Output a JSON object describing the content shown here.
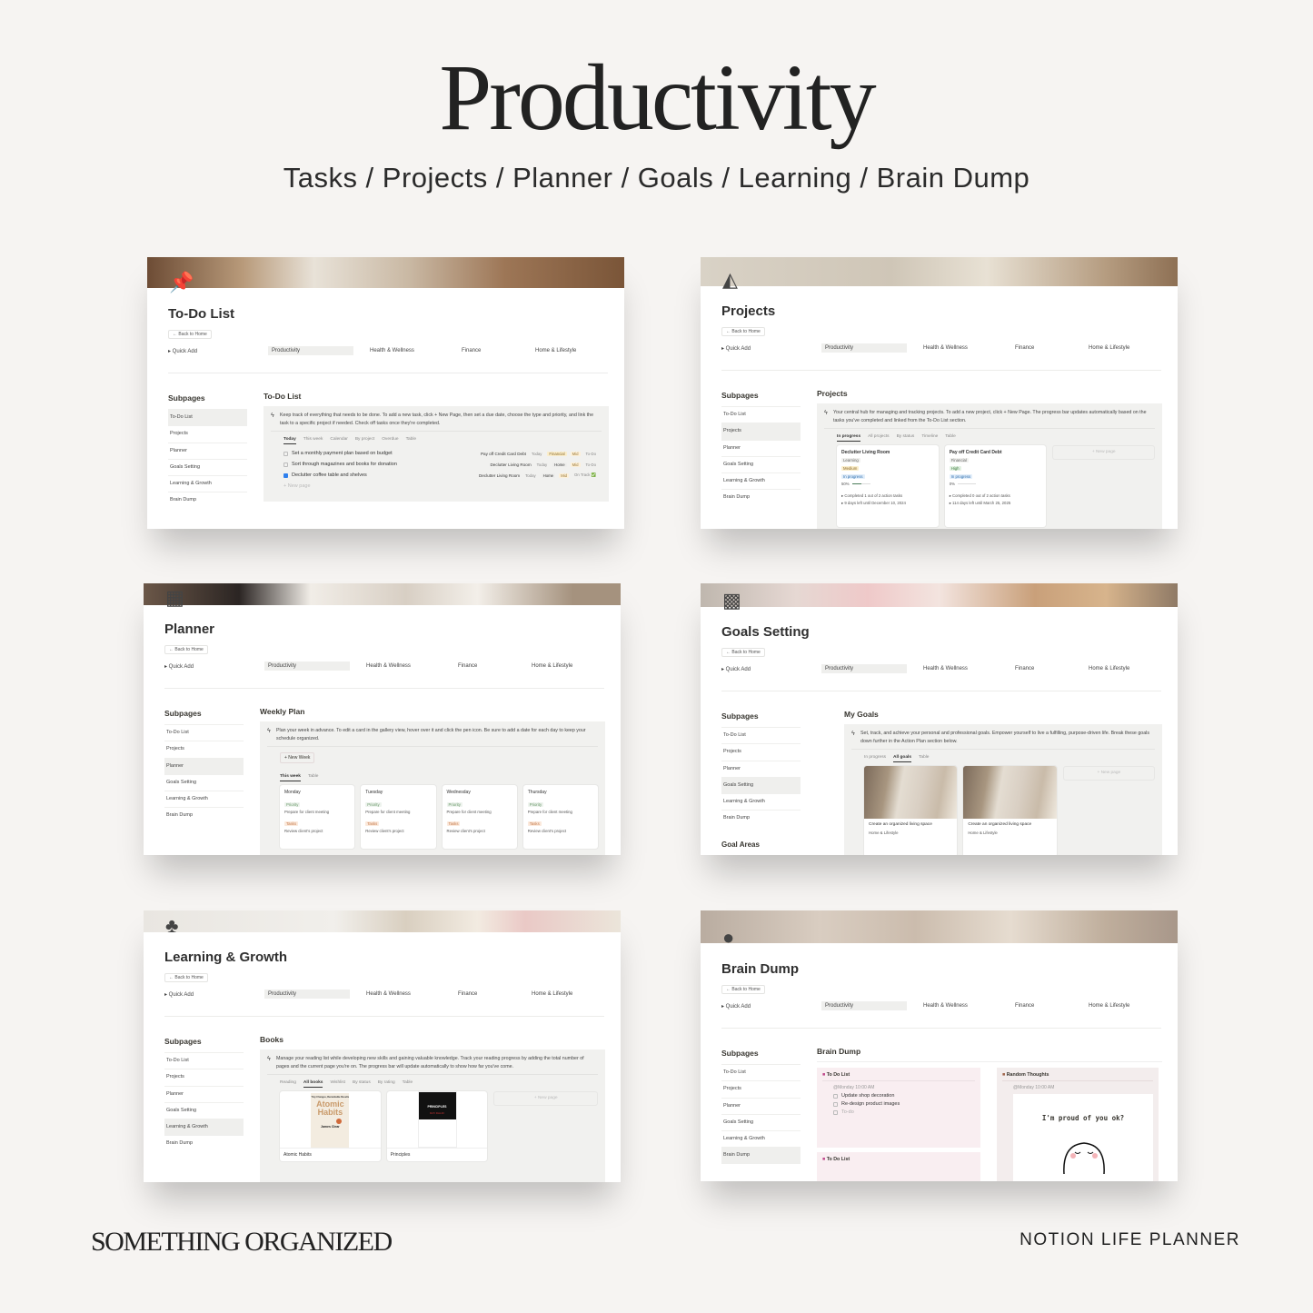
{
  "header": {
    "title": "Productivity",
    "subtitle": "Tasks / Projects / Planner / Goals / Learning / Brain Dump"
  },
  "footer": {
    "brand": "SOMETHING ORGANIZED",
    "product": "NOTION LIFE PLANNER"
  },
  "common": {
    "back_label": "← Back to Home",
    "quick_add": "▸  Quick Add",
    "nav": [
      "Productivity",
      "Health & Wellness",
      "Finance",
      "Home & Lifestyle"
    ],
    "subpages_heading": "Subpages",
    "subpages": [
      "To-Do List",
      "Projects",
      "Planner",
      "Goals Setting",
      "Learning & Growth",
      "Brain Dump"
    ],
    "new_page": "+ New page"
  },
  "todo": {
    "title": "To-Do List",
    "icon": "pushpin-icon",
    "section": "To-Do List",
    "callout": "Keep track of everything that needs to be done. To add a new task, click + New Page, then set a due date, choose the type and priority, and link the task to a specific project if needed. Check off tasks once they're completed.",
    "tabs": [
      "Today",
      "This week",
      "Calendar",
      "By project",
      "Overdue",
      "Table"
    ],
    "tasks": [
      {
        "name": "Set a monthly payment plan based on budget",
        "checked": false,
        "project": "Pay off Credit Card Debt",
        "date": "Today",
        "type": "Financial",
        "priority": "Mid",
        "status": "To-Do"
      },
      {
        "name": "Sort through magazines and books for donation",
        "checked": false,
        "project": "Declutter Living Room",
        "date": "Today",
        "type": "Home",
        "priority": "Mid",
        "status": "To-Do"
      },
      {
        "name": "Declutter coffee table and shelves",
        "checked": true,
        "project": "Declutter Living Room",
        "date": "Today",
        "type": "Home",
        "priority": "Mid",
        "status": "On Track ✅"
      }
    ]
  },
  "projects": {
    "title": "Projects",
    "icon": "shapes-icon",
    "section": "Projects",
    "callout": "Your central hub for managing and tracking projects. To add a new project, click + New Page. The progress bar updates automatically based on the tasks you've completed and linked from the To-Do List section.",
    "tabs": [
      "In progress",
      "All projects",
      "By status",
      "Timeline",
      "Table"
    ],
    "cards": [
      {
        "name": "Declutter Living Room",
        "category": "Learning",
        "priority": "Medium",
        "status": "In progress",
        "progress": "50%",
        "progress_value": 0.5,
        "completed": "▸ Completed 1 out of 2 action tasks",
        "due": "▸ 9 days left until December 10, 2024"
      },
      {
        "name": "Pay off Credit Card Debt",
        "category": "Financial",
        "priority": "High",
        "status": "In progress",
        "progress": "0%",
        "progress_value": 0,
        "completed": "▸ Completed 0 out of 2 action tasks",
        "due": "▸ 114 days left until March 25, 2025"
      }
    ]
  },
  "planner": {
    "title": "Planner",
    "icon": "calendar-icon",
    "section": "Weekly Plan",
    "callout": "Plan your week in advance. To edit a card in the gallery view, hover over it and click the pen icon. Be sure to add a date for each day to keep your schedule organized.",
    "new_week": "+ New Week",
    "tabs": [
      "This week",
      "Table"
    ],
    "days": [
      "Monday",
      "Tuesday",
      "Wednesday",
      "Thursday"
    ],
    "priority_label": "Priority",
    "priority_text": "Prepare for client meeting",
    "tasks_label": "Tasks",
    "task_text": "Review client's project"
  },
  "goals": {
    "title": "Goals Setting",
    "icon": "target-icon",
    "section": "My Goals",
    "callout": "Set, track, and achieve your personal and professional goals. Empower yourself to live a fulfilling, purpose-driven life. Break these goals down further in the Action Plan section below.",
    "tabs": [
      "In progress",
      "All goals",
      "Table"
    ],
    "card_title": "Create an organized living space",
    "card_area": "Home & Lifestyle",
    "goal_areas": "Goal Areas"
  },
  "learning": {
    "title": "Learning & Growth",
    "icon": "plant-icon",
    "section": "Books",
    "callout": "Manage your reading list while developing new skills and gaining valuable knowledge. Track your reading progress by adding the total number of pages and the current page you're on. The progress bar will update automatically to show how far you've come.",
    "tabs": [
      "Reading",
      "All books",
      "Wishlist",
      "By status",
      "By rating",
      "Table"
    ],
    "books": [
      {
        "name": "Atomic Habits",
        "cover_tagline": "Tiny Changes, Remarkable Results",
        "cover_title": "Atomic Habits",
        "cover_author": "James Clear"
      },
      {
        "name": "Principles",
        "cover_title": "PRINCIPLES",
        "cover_author": "RAY DALIO"
      }
    ]
  },
  "brain": {
    "title": "Brain Dump",
    "icon": "thought-bubble-icon",
    "section": "Brain Dump",
    "todo_title": "To Do List",
    "date": "@Monday 10:00 AM",
    "items": [
      "Update shop decoration",
      "Re-design product images",
      "To-do"
    ],
    "thoughts_title": "Random Thoughts",
    "thoughts_image_text": "I'm proud of you ok?"
  }
}
